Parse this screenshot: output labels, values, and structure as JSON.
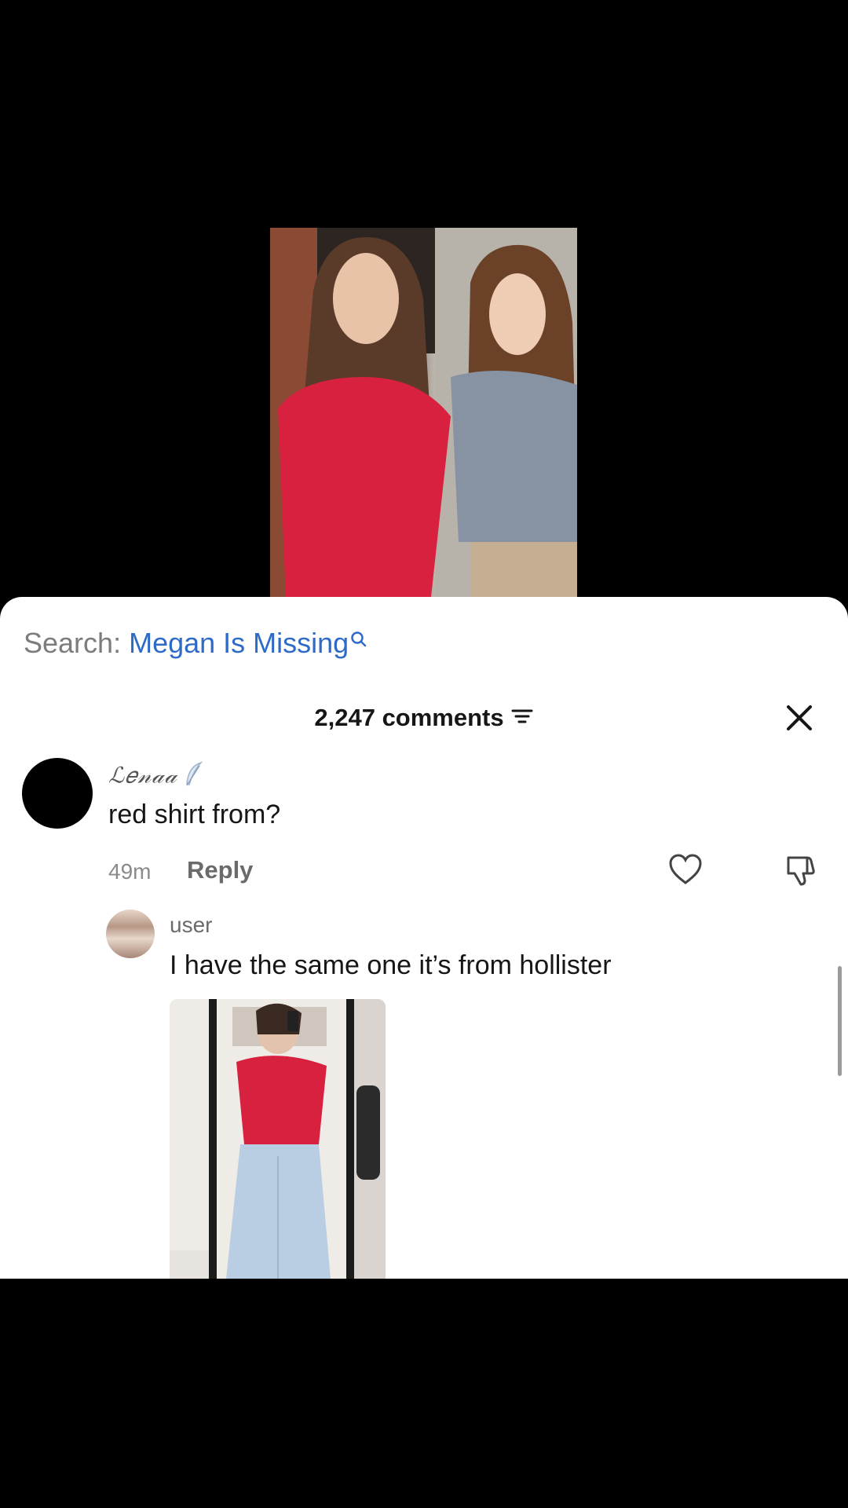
{
  "search": {
    "prefix": "Search:",
    "query": "Megan Is Missing"
  },
  "comments_header": {
    "count_label": "2,247 comments"
  },
  "comment": {
    "username": "ℒ𝑒𝓃𝒶𝒶",
    "text": "red shirt from?",
    "time": "49m",
    "reply_label": "Reply"
  },
  "reply_comment": {
    "username": "user",
    "text": "I have the same one it’s from hollister"
  },
  "colors": {
    "accent_blue": "#2e6bc9",
    "shirt_red": "#d8213f",
    "background": "#000000"
  },
  "icons": [
    "search-icon",
    "sort-icon",
    "close-icon",
    "feather-icon",
    "heart-icon",
    "dislike-icon"
  ]
}
